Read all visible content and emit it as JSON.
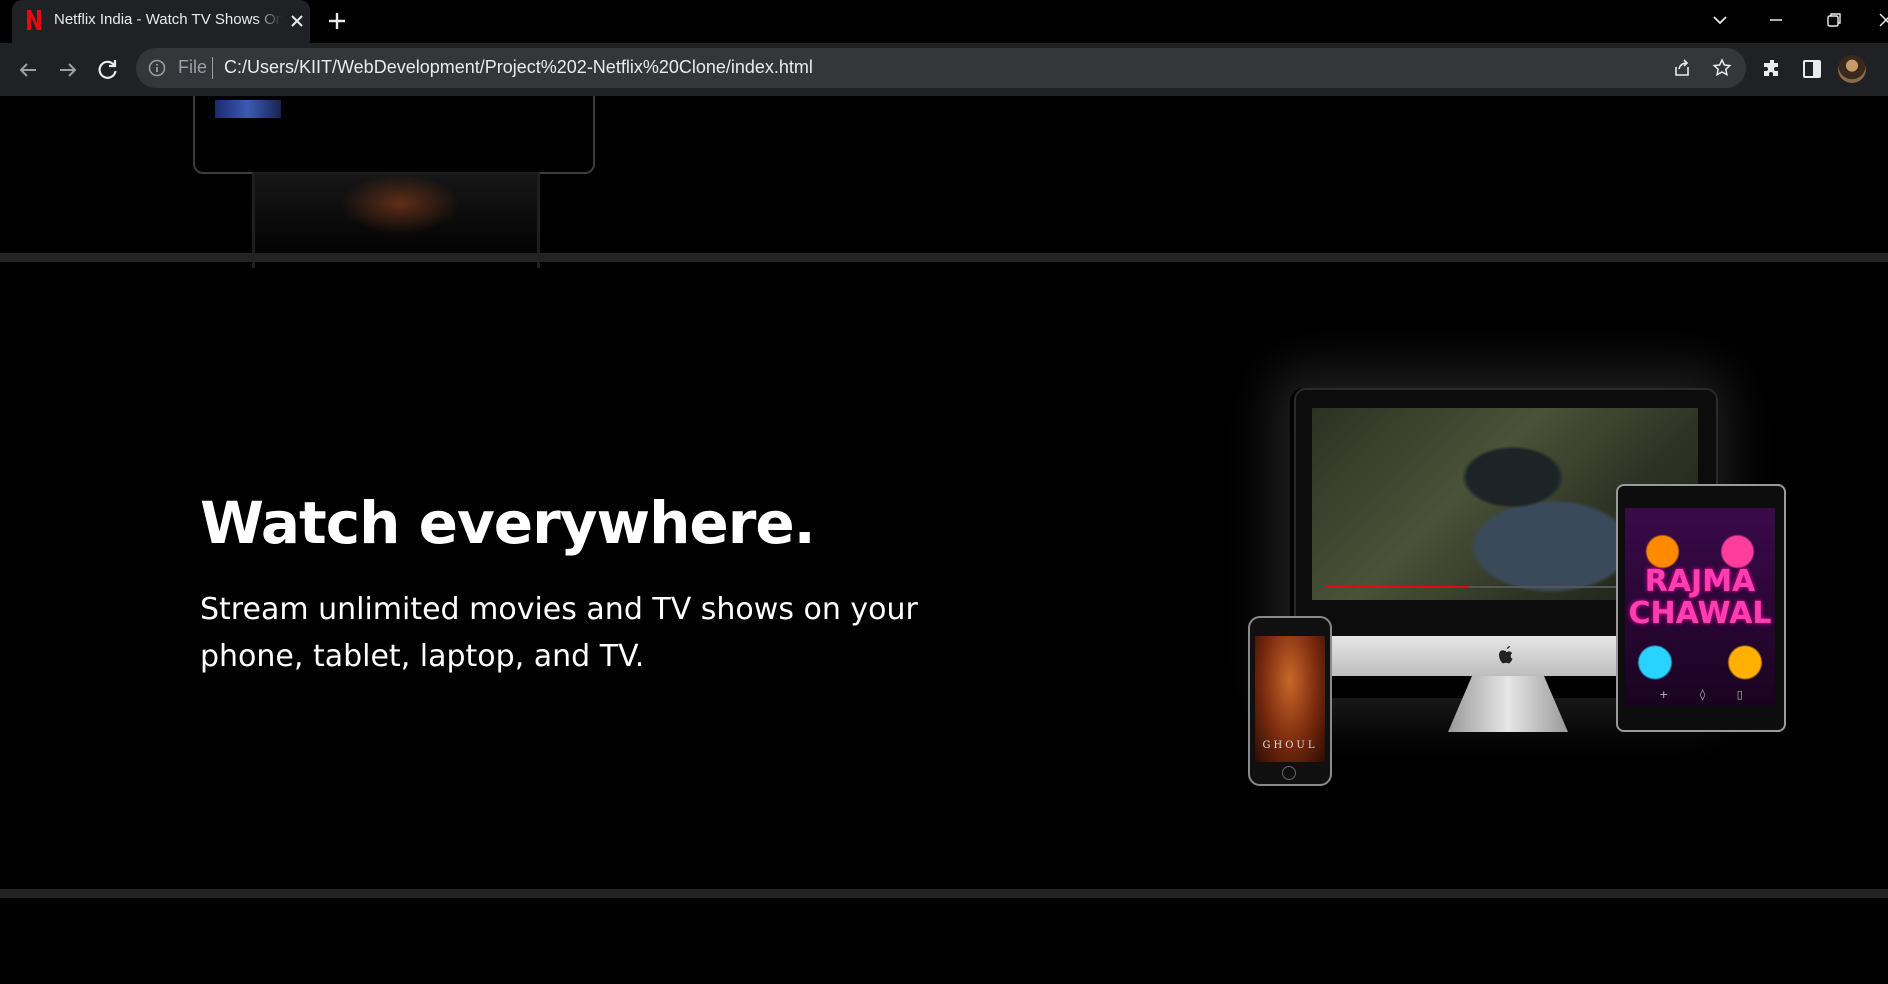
{
  "browser": {
    "tab": {
      "title": "Netflix India - Watch TV Shows Online, Watch Movies Online",
      "favicon": "netflix-n-icon",
      "accent": "#e50914"
    },
    "address_bar": {
      "scheme_label": "File",
      "url": "C:/Users/KIIT/WebDevelopment/Project%202-Netflix%20Clone/index.html"
    }
  },
  "page": {
    "feature": {
      "headline": "Watch everywhere.",
      "subtext": "Stream unlimited movies and TV shows on your phone, tablet, laptop, and TV."
    },
    "devices": {
      "phone_title": "GHOUL",
      "tablet_title": "RAJMA CHAWAL"
    },
    "colors": {
      "background": "#000000",
      "divider": "#232323",
      "text": "#ffffff"
    }
  }
}
